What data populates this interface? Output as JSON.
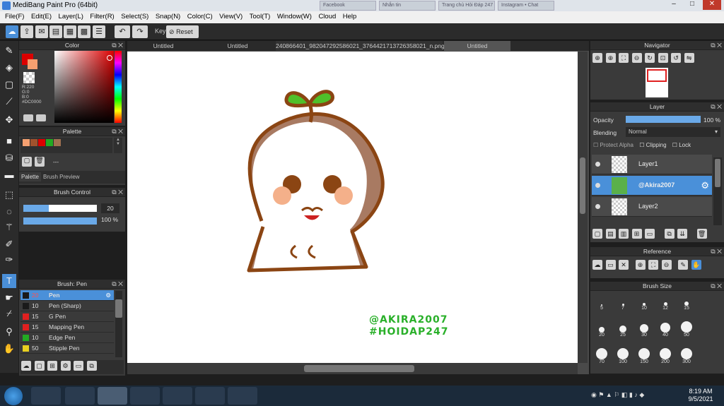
{
  "window": {
    "title": "MediBang Paint Pro (64bit)"
  },
  "browser_tabs": [
    "Facebook",
    "Nhắn tin",
    "Trang chủ Hỏi Đáp 247",
    "Instagram • Chat"
  ],
  "menu": [
    "File(F)",
    "Edit(E)",
    "Layer(L)",
    "Filter(R)",
    "Select(S)",
    "Snap(N)",
    "Color(C)",
    "View(V)",
    "Tool(T)",
    "Window(W)",
    "Cloud",
    "Help"
  ],
  "toolbar": {
    "key_label": "Key",
    "reset_label": "Reset"
  },
  "color_panel": {
    "title": "Color",
    "r": "R:220",
    "g": "G:0",
    "b": "B:0",
    "hex": "#DC0000",
    "primary": "#DC0000",
    "secondary": "#F5A070"
  },
  "palette_panel": {
    "title": "Palette",
    "swatches": [
      "#f5a070",
      "#a0522d",
      "#dc0000",
      "#22aa22",
      "#a07050"
    ],
    "name_value": "---",
    "tabs": [
      "Palette",
      "Brush Preview"
    ]
  },
  "brush_control": {
    "title": "Brush Control",
    "size": "20",
    "opacity": "100 %",
    "size_fill": 0.35,
    "opacity_fill": 1.0
  },
  "brush_list": {
    "title": "Brush: Pen",
    "items": [
      {
        "size": "20",
        "name": "Pen",
        "color": "#1a1a1a",
        "selected": true
      },
      {
        "size": "10",
        "name": "Pen (Sharp)",
        "color": "#1a1a1a",
        "selected": false
      },
      {
        "size": "15",
        "name": "G Pen",
        "color": "#e02020",
        "selected": false
      },
      {
        "size": "15",
        "name": "Mapping Pen",
        "color": "#e02020",
        "selected": false
      },
      {
        "size": "10",
        "name": "Edge Pen",
        "color": "#22aa22",
        "selected": false
      },
      {
        "size": "50",
        "name": "Stipple Pen",
        "color": "#e8d020",
        "selected": false
      }
    ]
  },
  "document_tabs": [
    "Untitled",
    "Untitled",
    "240866401_982047292586021_3764421713726358021_n.png",
    "Untitled"
  ],
  "canvas": {
    "watermark_line1": "@AKIRA2007",
    "watermark_line2": "#HOIDAP247"
  },
  "navigator": {
    "title": "Navigator"
  },
  "layer_panel": {
    "title": "Layer",
    "opacity_label": "Opacity",
    "opacity_value": "100 %",
    "blending_label": "Blending",
    "blending_value": "Normal",
    "protect_alpha": "Protect Alpha",
    "clipping": "Clipping",
    "lock": "Lock",
    "layers": [
      {
        "name": "Layer1",
        "selected": false
      },
      {
        "name": "@Akira2007",
        "selected": true
      },
      {
        "name": "Layer2",
        "selected": false
      }
    ]
  },
  "reference": {
    "title": "Reference"
  },
  "brush_size": {
    "title": "Brush Size",
    "sizes": [
      "5",
      "7",
      "10",
      "12",
      "15",
      "20",
      "25",
      "30",
      "40",
      "50",
      "70",
      "100",
      "150",
      "200",
      "300"
    ]
  },
  "taskbar": {
    "time": "8:19 AM",
    "date": "9/5/2021"
  }
}
